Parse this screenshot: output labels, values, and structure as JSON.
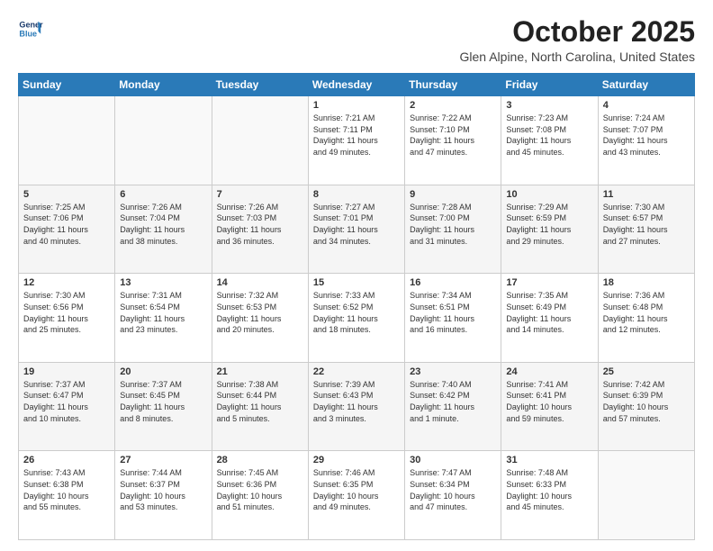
{
  "header": {
    "logo_line1": "General",
    "logo_line2": "Blue",
    "title": "October 2025",
    "subtitle": "Glen Alpine, North Carolina, United States"
  },
  "days_of_week": [
    "Sunday",
    "Monday",
    "Tuesday",
    "Wednesday",
    "Thursday",
    "Friday",
    "Saturday"
  ],
  "weeks": [
    [
      {
        "day": "",
        "info": ""
      },
      {
        "day": "",
        "info": ""
      },
      {
        "day": "",
        "info": ""
      },
      {
        "day": "1",
        "info": "Sunrise: 7:21 AM\nSunset: 7:11 PM\nDaylight: 11 hours\nand 49 minutes."
      },
      {
        "day": "2",
        "info": "Sunrise: 7:22 AM\nSunset: 7:10 PM\nDaylight: 11 hours\nand 47 minutes."
      },
      {
        "day": "3",
        "info": "Sunrise: 7:23 AM\nSunset: 7:08 PM\nDaylight: 11 hours\nand 45 minutes."
      },
      {
        "day": "4",
        "info": "Sunrise: 7:24 AM\nSunset: 7:07 PM\nDaylight: 11 hours\nand 43 minutes."
      }
    ],
    [
      {
        "day": "5",
        "info": "Sunrise: 7:25 AM\nSunset: 7:06 PM\nDaylight: 11 hours\nand 40 minutes."
      },
      {
        "day": "6",
        "info": "Sunrise: 7:26 AM\nSunset: 7:04 PM\nDaylight: 11 hours\nand 38 minutes."
      },
      {
        "day": "7",
        "info": "Sunrise: 7:26 AM\nSunset: 7:03 PM\nDaylight: 11 hours\nand 36 minutes."
      },
      {
        "day": "8",
        "info": "Sunrise: 7:27 AM\nSunset: 7:01 PM\nDaylight: 11 hours\nand 34 minutes."
      },
      {
        "day": "9",
        "info": "Sunrise: 7:28 AM\nSunset: 7:00 PM\nDaylight: 11 hours\nand 31 minutes."
      },
      {
        "day": "10",
        "info": "Sunrise: 7:29 AM\nSunset: 6:59 PM\nDaylight: 11 hours\nand 29 minutes."
      },
      {
        "day": "11",
        "info": "Sunrise: 7:30 AM\nSunset: 6:57 PM\nDaylight: 11 hours\nand 27 minutes."
      }
    ],
    [
      {
        "day": "12",
        "info": "Sunrise: 7:30 AM\nSunset: 6:56 PM\nDaylight: 11 hours\nand 25 minutes."
      },
      {
        "day": "13",
        "info": "Sunrise: 7:31 AM\nSunset: 6:54 PM\nDaylight: 11 hours\nand 23 minutes."
      },
      {
        "day": "14",
        "info": "Sunrise: 7:32 AM\nSunset: 6:53 PM\nDaylight: 11 hours\nand 20 minutes."
      },
      {
        "day": "15",
        "info": "Sunrise: 7:33 AM\nSunset: 6:52 PM\nDaylight: 11 hours\nand 18 minutes."
      },
      {
        "day": "16",
        "info": "Sunrise: 7:34 AM\nSunset: 6:51 PM\nDaylight: 11 hours\nand 16 minutes."
      },
      {
        "day": "17",
        "info": "Sunrise: 7:35 AM\nSunset: 6:49 PM\nDaylight: 11 hours\nand 14 minutes."
      },
      {
        "day": "18",
        "info": "Sunrise: 7:36 AM\nSunset: 6:48 PM\nDaylight: 11 hours\nand 12 minutes."
      }
    ],
    [
      {
        "day": "19",
        "info": "Sunrise: 7:37 AM\nSunset: 6:47 PM\nDaylight: 11 hours\nand 10 minutes."
      },
      {
        "day": "20",
        "info": "Sunrise: 7:37 AM\nSunset: 6:45 PM\nDaylight: 11 hours\nand 8 minutes."
      },
      {
        "day": "21",
        "info": "Sunrise: 7:38 AM\nSunset: 6:44 PM\nDaylight: 11 hours\nand 5 minutes."
      },
      {
        "day": "22",
        "info": "Sunrise: 7:39 AM\nSunset: 6:43 PM\nDaylight: 11 hours\nand 3 minutes."
      },
      {
        "day": "23",
        "info": "Sunrise: 7:40 AM\nSunset: 6:42 PM\nDaylight: 11 hours\nand 1 minute."
      },
      {
        "day": "24",
        "info": "Sunrise: 7:41 AM\nSunset: 6:41 PM\nDaylight: 10 hours\nand 59 minutes."
      },
      {
        "day": "25",
        "info": "Sunrise: 7:42 AM\nSunset: 6:39 PM\nDaylight: 10 hours\nand 57 minutes."
      }
    ],
    [
      {
        "day": "26",
        "info": "Sunrise: 7:43 AM\nSunset: 6:38 PM\nDaylight: 10 hours\nand 55 minutes."
      },
      {
        "day": "27",
        "info": "Sunrise: 7:44 AM\nSunset: 6:37 PM\nDaylight: 10 hours\nand 53 minutes."
      },
      {
        "day": "28",
        "info": "Sunrise: 7:45 AM\nSunset: 6:36 PM\nDaylight: 10 hours\nand 51 minutes."
      },
      {
        "day": "29",
        "info": "Sunrise: 7:46 AM\nSunset: 6:35 PM\nDaylight: 10 hours\nand 49 minutes."
      },
      {
        "day": "30",
        "info": "Sunrise: 7:47 AM\nSunset: 6:34 PM\nDaylight: 10 hours\nand 47 minutes."
      },
      {
        "day": "31",
        "info": "Sunrise: 7:48 AM\nSunset: 6:33 PM\nDaylight: 10 hours\nand 45 minutes."
      },
      {
        "day": "",
        "info": ""
      }
    ]
  ]
}
